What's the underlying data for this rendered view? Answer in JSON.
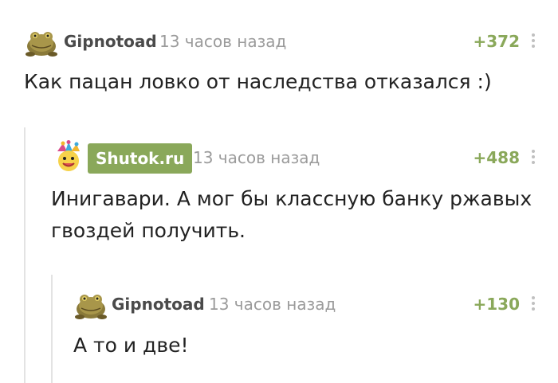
{
  "comments": [
    {
      "author": "Gipnotoad",
      "time": "13 часов назад",
      "rating": "+372",
      "text": "Как пацан ловко от наследства отказался :)",
      "avatar_icon": "toad-avatar-icon"
    },
    {
      "author": "Shutok.ru",
      "time": "13 часов назад",
      "rating": "+488",
      "text_line1": "Инигавари. А мог бы классную банку ржавых",
      "text_line2": "гвоздей получить.",
      "avatar_icon": "jester-avatar-icon",
      "badge_color": "#8aa85a"
    },
    {
      "author": "Gipnotoad",
      "time": "13 часов назад",
      "rating": "+130",
      "text": "А то и две!",
      "avatar_icon": "toad-avatar-icon"
    }
  ],
  "colors": {
    "rating": "#8aa85a",
    "author": "#4a4a4a",
    "time": "#9b9b9b",
    "thread_line": "#e3e3e3"
  }
}
